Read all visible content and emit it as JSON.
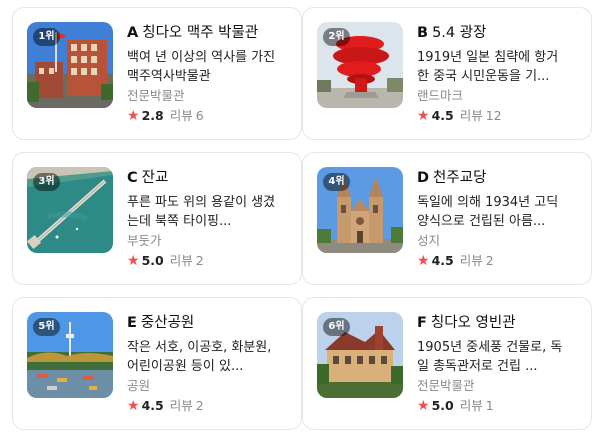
{
  "cards": [
    {
      "rank": "1위",
      "letter": "A",
      "name": "칭다오 맥주 박물관",
      "desc": "백여 년 이상의 역사를 가진 맥주역사박물관",
      "category": "전문박물관",
      "star": "★",
      "rating": "2.8",
      "review_label": "리뷰",
      "review_count": "6",
      "image": "brick-museum"
    },
    {
      "rank": "2위",
      "letter": "B",
      "name": "5.4 광장",
      "desc": "1919년 일본 침략에 항거한 중국 시민운동을 기...",
      "category": "랜드마크",
      "star": "★",
      "rating": "4.5",
      "review_label": "리뷰",
      "review_count": "12",
      "image": "red-sculpture"
    },
    {
      "rank": "3위",
      "letter": "C",
      "name": "잔교",
      "desc": "푸른 파도 위의 용같이 생겼는데 북쪽 타이핑...",
      "category": "부둣가",
      "star": "★",
      "rating": "5.0",
      "review_label": "리뷰",
      "review_count": "2",
      "image": "pier-aerial"
    },
    {
      "rank": "4위",
      "letter": "D",
      "name": "천주교당",
      "desc": "독일에 의해 1934년 고딕 양식으로 건립된 아름...",
      "category": "성지",
      "star": "★",
      "rating": "4.5",
      "review_label": "리뷰",
      "review_count": "2",
      "image": "cathedral"
    },
    {
      "rank": "5위",
      "letter": "E",
      "name": "중산공원",
      "desc": "작은 서호, 이공호, 화분원, 어린이공원 등이 있...",
      "category": "공원",
      "star": "★",
      "rating": "4.5",
      "review_label": "리뷰",
      "review_count": "2",
      "image": "park-tower"
    },
    {
      "rank": "6위",
      "letter": "F",
      "name": "칭다오 영빈관",
      "desc": "1905년 중세풍 건물로, 독일 총독관저로 건립 ...",
      "category": "전문박물관",
      "star": "★",
      "rating": "5.0",
      "review_label": "리뷰",
      "review_count": "1",
      "image": "guest-house"
    }
  ]
}
